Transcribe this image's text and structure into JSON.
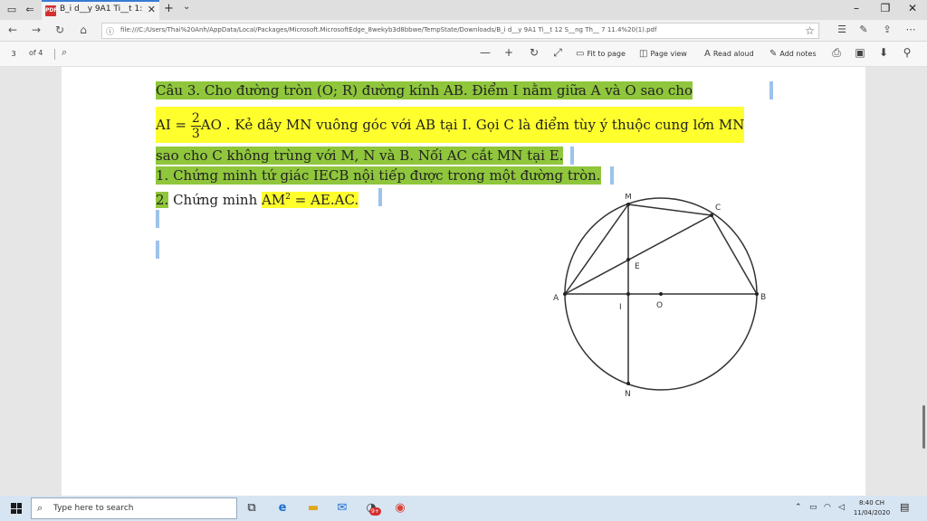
{
  "tab": {
    "title": "B_i d__y 9A1 Ti__t 1:"
  },
  "address": {
    "url": "file:///C:/Users/Thai%20Anh/AppData/Local/Packages/Microsoft.MicrosoftEdge_8wekyb3d8bbwe/TempState/Downloads/B_i d__y 9A1 Ti__t 12 S__ng Th__ 7 11.4%20(1).pdf"
  },
  "pdf_toolbar": {
    "page_current": "3",
    "page_total": "of 4",
    "fit_to_page": "Fit to page",
    "page_view": "Page view",
    "read_aloud": "Read aloud",
    "add_notes": "Add notes"
  },
  "document": {
    "line1": "Câu 3. Cho đường tròn (O; R) đường kính AB. Điểm I nằm giữa A và O sao cho",
    "line2_a": "AI = ",
    "line2_frac_num": "2",
    "line2_frac_den": "3",
    "line2_b": "AO . Kẻ dây MN vuông góc với AB tại I. Gọi C là điểm tùy ý thuộc cung lớn MN",
    "line3": "sao cho C không trùng với M, N và B. Nối AC cắt MN tại E.",
    "line4": "1.  Chứng minh tứ giác IECB nội tiếp được trong một đường tròn.",
    "line5_num": "2.",
    "line5_a": " Chứng minh ",
    "line5_b": "AM",
    "line5_sup": "2",
    "line5_c": " = AE.AC."
  },
  "figure": {
    "labels": {
      "M": "M",
      "C": "C",
      "E": "E",
      "A": "A",
      "I": "I",
      "O": "O",
      "B": "B",
      "N": "N"
    }
  },
  "taskbar": {
    "search_placeholder": "Type here to search",
    "time": "8:40 CH",
    "date": "11/04/2020",
    "mail_badge": "9+"
  },
  "colors": {
    "highlight_green": "#8fc63c",
    "highlight_yellow": "#ffff2e",
    "selection_blue": "#9cc3ec",
    "pdf_red": "#d42f2f"
  }
}
